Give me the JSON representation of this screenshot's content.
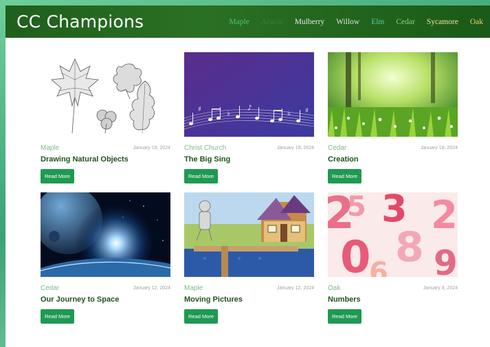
{
  "header": {
    "site_title": "CC Champions",
    "nav": [
      {
        "label": "Maple",
        "color": "#4fc27a"
      },
      {
        "label": "Acacia",
        "color": "#3f7a3a"
      },
      {
        "label": "Mulberry",
        "color": "#e8e8e8"
      },
      {
        "label": "Willow",
        "color": "#e0e0e0"
      },
      {
        "label": "Elm",
        "color": "#5fc7a0"
      },
      {
        "label": "Cedar",
        "color": "#8fd07a"
      },
      {
        "label": "Sycamore",
        "color": "#f0e6a0"
      },
      {
        "label": "Oak",
        "color": "#e8d36a"
      }
    ]
  },
  "posts": [
    {
      "category": "Maple",
      "date": "January 19, 2024",
      "title": "Drawing Natural Objects",
      "button": "Read More",
      "image": "leaves-sketch"
    },
    {
      "category": "Christ Church",
      "date": "January 19, 2024",
      "title": "The Big Sing",
      "button": "Read More",
      "image": "music-notes"
    },
    {
      "category": "Cedar",
      "date": "January 18, 2024",
      "title": "Creation",
      "button": "Read More",
      "image": "sunlit-meadow"
    },
    {
      "category": "Cedar",
      "date": "January 12, 2024",
      "title": "Our Journey to Space",
      "button": "Read More",
      "image": "space-planet"
    },
    {
      "category": "Maple",
      "date": "January 12, 2024",
      "title": "Moving Pictures",
      "button": "Read More",
      "image": "paper-puppet-house"
    },
    {
      "category": "Oak",
      "date": "January 8, 2024",
      "title": "Numbers",
      "button": "Read More",
      "image": "number-toys"
    }
  ]
}
